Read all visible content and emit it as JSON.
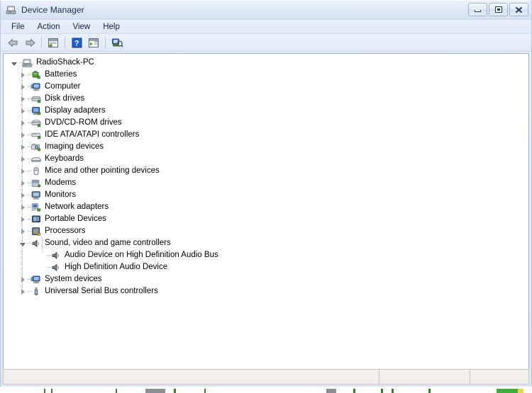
{
  "window": {
    "title": "Device Manager",
    "icon": "device-manager-icon",
    "controls": {
      "minimize": "Minimize",
      "maximize": "Maximize",
      "close": "Close"
    }
  },
  "menu": {
    "items": [
      {
        "label": "File"
      },
      {
        "label": "Action"
      },
      {
        "label": "View"
      },
      {
        "label": "Help"
      }
    ]
  },
  "toolbar": {
    "buttons": [
      {
        "name": "back-button",
        "icon": "back-arrow-icon",
        "enabled": false
      },
      {
        "name": "forward-button",
        "icon": "forward-arrow-icon",
        "enabled": false
      },
      {
        "name": "properties-button",
        "icon": "properties-icon"
      },
      {
        "name": "help-button",
        "icon": "help-question-icon"
      },
      {
        "name": "show-hide-console-tree-button",
        "icon": "console-tree-icon"
      },
      {
        "name": "scan-for-hardware-changes-button",
        "icon": "scan-hardware-icon"
      }
    ]
  },
  "tree": {
    "root": {
      "label": "RadioShack-PC",
      "icon": "computer-root-icon",
      "expanded": true
    },
    "nodes": [
      {
        "label": "Batteries",
        "icon": "battery-icon",
        "expanded": false,
        "level": 1
      },
      {
        "label": "Computer",
        "icon": "computer-icon",
        "expanded": false,
        "level": 1
      },
      {
        "label": "Disk drives",
        "icon": "disk-drive-icon",
        "expanded": false,
        "level": 1
      },
      {
        "label": "Display adapters",
        "icon": "display-adapter-icon",
        "expanded": false,
        "level": 1
      },
      {
        "label": "DVD/CD-ROM drives",
        "icon": "dvd-drive-icon",
        "expanded": false,
        "level": 1
      },
      {
        "label": "IDE ATA/ATAPI controllers",
        "icon": "ide-controller-icon",
        "expanded": false,
        "level": 1
      },
      {
        "label": "Imaging devices",
        "icon": "imaging-device-icon",
        "expanded": false,
        "level": 1
      },
      {
        "label": "Keyboards",
        "icon": "keyboard-icon",
        "expanded": false,
        "level": 1
      },
      {
        "label": "Mice and other pointing devices",
        "icon": "mouse-icon",
        "expanded": false,
        "level": 1
      },
      {
        "label": "Modems",
        "icon": "modem-icon",
        "expanded": false,
        "level": 1
      },
      {
        "label": "Monitors",
        "icon": "monitor-icon",
        "expanded": false,
        "level": 1
      },
      {
        "label": "Network adapters",
        "icon": "network-adapter-icon",
        "expanded": false,
        "level": 1
      },
      {
        "label": "Portable Devices",
        "icon": "portable-device-icon",
        "expanded": false,
        "level": 1
      },
      {
        "label": "Processors",
        "icon": "processor-icon",
        "expanded": false,
        "level": 1
      },
      {
        "label": "Sound, video and game controllers",
        "icon": "speaker-icon",
        "expanded": true,
        "level": 1
      },
      {
        "label": "Audio Device on High Definition Audio Bus",
        "icon": "speaker-icon",
        "expanded": null,
        "level": 2
      },
      {
        "label": "High Definition Audio Device",
        "icon": "speaker-icon",
        "expanded": null,
        "level": 2
      },
      {
        "label": "System devices",
        "icon": "system-device-icon",
        "expanded": false,
        "level": 1
      },
      {
        "label": "Universal Serial Bus controllers",
        "icon": "usb-controller-icon",
        "expanded": false,
        "level": 1
      }
    ]
  },
  "statusbar": {
    "panes": [
      {
        "text": ""
      },
      {
        "text": ""
      },
      {
        "text": ""
      }
    ]
  },
  "colors": {
    "title_bar_top": "#e9f0fa",
    "chrome": "#dde7f4",
    "tree_background": "#ffffff",
    "status_background": "#f1eeec",
    "desktop": "#dfe8f5",
    "text": "#000000"
  }
}
